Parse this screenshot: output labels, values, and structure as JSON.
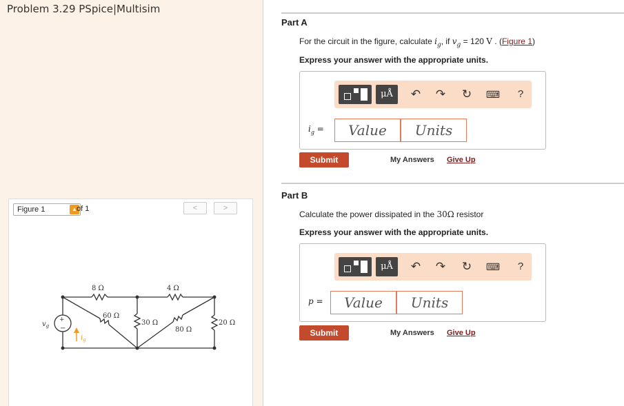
{
  "problem_title": "Problem 3.29 PSpice|Multisim",
  "figure": {
    "select_value": "Figure 1",
    "of_label": "of 1",
    "prev": "<",
    "next": ">",
    "labels": {
      "r8": "8 Ω",
      "r4": "4 Ω",
      "r60": "60 Ω",
      "r30": "30 Ω",
      "r80": "80 Ω",
      "r20": "20 Ω",
      "vg": "v",
      "vg_sub": "g",
      "ig": "i",
      "ig_sub": "g",
      "plus": "+",
      "minus": "−"
    }
  },
  "partA": {
    "header": "Part A",
    "q_pre": "For the circuit in the figure, calculate ",
    "q_var": "i",
    "q_var_sub": "g",
    "q_mid": ", if ",
    "q_var2": "v",
    "q_var2_sub": "g",
    "q_eq": " = 120 ",
    "q_unit": "V",
    "q_sep": " . (",
    "q_link": "Figure 1",
    "q_close": ")",
    "express": "Express your answer with the appropriate units.",
    "unit_btn": "μÅ",
    "eq_label": "i",
    "eq_sub": "g",
    "eq_sign": " =",
    "value_ph": "Value",
    "units_ph": "Units",
    "submit": "Submit",
    "my_answers": "My Answers",
    "give_up": "Give Up"
  },
  "partB": {
    "header": "Part B",
    "q_pre": "Calculate the power dissipated in the ",
    "q_res": "30Ω",
    "q_post": " resistor",
    "express": "Express your answer with the appropriate units.",
    "unit_btn": "μÅ",
    "eq_label": "p",
    "eq_sign": " =",
    "value_ph": "Value",
    "units_ph": "Units",
    "submit": "Submit",
    "my_answers": "My Answers",
    "give_up": "Give Up"
  },
  "toolbar_icons": [
    "template-icon",
    "units-icon",
    "undo-icon",
    "redo-icon",
    "reset-icon",
    "keyboard-icon",
    "help-icon"
  ],
  "colors": {
    "accent": "#c34a2c",
    "toolbar_bg": "#fbdcc6",
    "left_bg": "#fdf2e7",
    "link": "#7a1c1c"
  }
}
